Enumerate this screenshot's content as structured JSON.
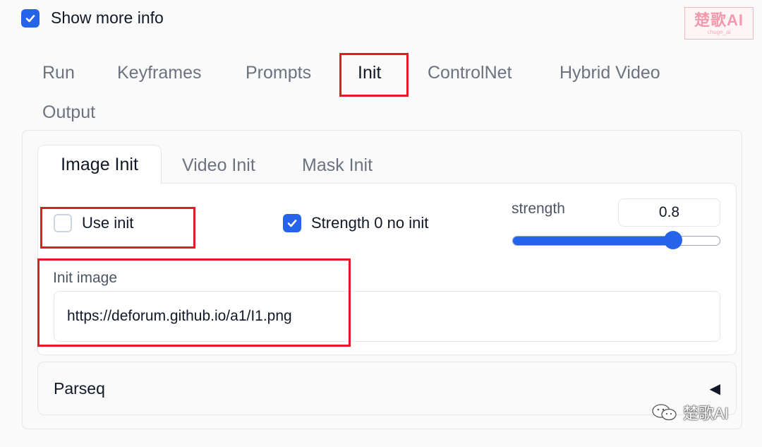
{
  "options": {
    "show_more_info": {
      "label": "Show more info",
      "checked": true
    }
  },
  "watermark": {
    "main": "楚歌AI",
    "sub": "chuge_ai"
  },
  "tabs": [
    {
      "label": "Run",
      "active": false
    },
    {
      "label": "Keyframes",
      "active": false
    },
    {
      "label": "Prompts",
      "active": false
    },
    {
      "label": "Init",
      "active": true
    },
    {
      "label": "ControlNet",
      "active": false
    },
    {
      "label": "Hybrid Video",
      "active": false
    },
    {
      "label": "Output",
      "active": false
    }
  ],
  "init_subtabs": [
    {
      "label": "Image Init",
      "active": true
    },
    {
      "label": "Video Init",
      "active": false
    },
    {
      "label": "Mask Init",
      "active": false
    }
  ],
  "image_init": {
    "use_init": {
      "label": "Use init",
      "checked": false
    },
    "strength_0_no_init": {
      "label": "Strength 0 no init",
      "checked": true
    },
    "strength": {
      "label": "strength",
      "value": "0.8",
      "slider_fraction": 0.8
    },
    "init_image": {
      "label": "Init image",
      "value": "https://deforum.github.io/a1/I1.png"
    }
  },
  "parseq": {
    "label": "Parseq",
    "arrow": "◀"
  },
  "footer_watermark": {
    "text": "楚歌AI",
    "icon": "wechat-icon"
  },
  "colors": {
    "accent": "#2563eb",
    "highlight": "#e11d24"
  }
}
